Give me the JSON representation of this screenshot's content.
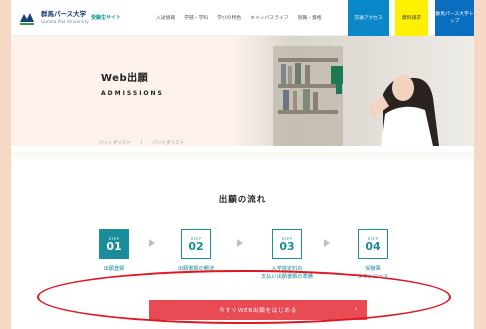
{
  "header": {
    "brand_name": "群馬パース大学",
    "brand_sub": "Gunma Paz University",
    "site_link": "受験生サイト",
    "nav": [
      "入試情報",
      "学部・学科",
      "学びの特色",
      "キャンパスライフ",
      "就職・資格"
    ],
    "access_label": "交通アクセス",
    "request_label": "資料請求",
    "university_label": "群馬パース大学トップ"
  },
  "hero": {
    "title": "Web出願",
    "subtitle": "ADMISSIONS"
  },
  "breadcrumb": [
    "パンくずリスト",
    "パンくずリスト"
  ],
  "flow": {
    "title": "出願の流れ",
    "steps": [
      {
        "label": "STEP",
        "num": "01",
        "caption": "出願登録"
      },
      {
        "label": "STEP",
        "num": "02",
        "caption": "出願書類の郵送"
      },
      {
        "label": "STEP",
        "num": "03",
        "caption_line1": "入学検定料の",
        "caption_line2": "支払い出願書類の準備"
      },
      {
        "label": "STEP",
        "num": "04",
        "caption_line1": "受験票",
        "caption_line2": "ダウンロード"
      }
    ]
  },
  "cta": {
    "label": "今すぐWEB出願をはじめる",
    "chevron": "›"
  },
  "colors": {
    "accent": "#1a8c9a",
    "cta": "#e94b55",
    "annotation": "#e01620",
    "frame": "#f7d8c4"
  }
}
